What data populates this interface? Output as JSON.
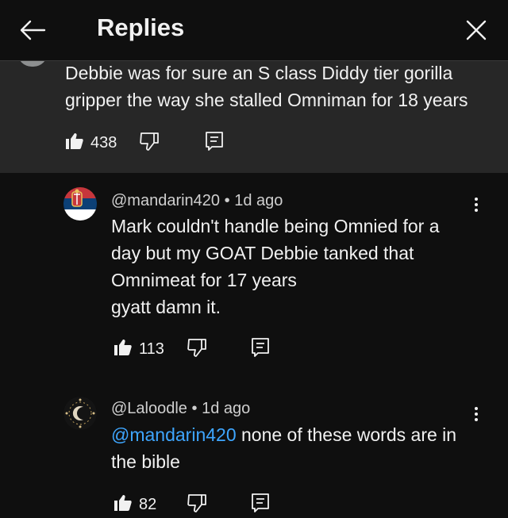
{
  "header": {
    "title": "Replies",
    "back_icon": "arrow-left-icon",
    "close_icon": "close-icon"
  },
  "parent_comment": {
    "text_line1": "Debbie was for sure an S class Diddy tier gorilla",
    "text_line2": "gripper the way she stalled Omniman for 18 years",
    "likes": "438"
  },
  "replies": [
    {
      "author": "@mandarin420",
      "separator": "•",
      "time": "1d ago",
      "lines": [
        "Mark couldn't handle being Omnied for a",
        "day but my GOAT Debbie tanked that",
        "Omnimeat for 17 years",
        "gyatt damn it."
      ],
      "likes": "113",
      "avatar": "serbia-flag-avatar"
    },
    {
      "author": "@Laloodle",
      "separator": "•",
      "time": "1d ago",
      "mention": "@mandarin420",
      "line1_rest": " none of these words are in",
      "line2": "the bible",
      "likes": "82",
      "avatar": "moon-crest-avatar"
    }
  ],
  "colors": {
    "background": "#0f0f0f",
    "highlight": "#272727",
    "text": "#f1f1f1",
    "link": "#3ea6ff"
  }
}
